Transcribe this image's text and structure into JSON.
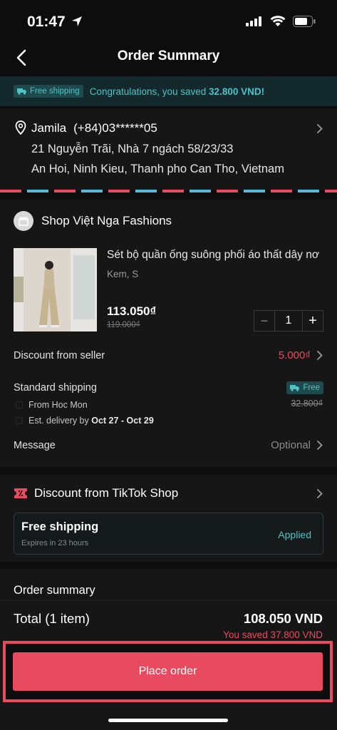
{
  "status": {
    "time": "01:47"
  },
  "header": {
    "title": "Order Summary"
  },
  "banner": {
    "tag": "Free shipping",
    "text": "Congratulations, you saved ",
    "amount": "32.800 VND!"
  },
  "address": {
    "name": "Jamila",
    "phone": "(+84)03******05",
    "line1": "21 Nguyễn Trãi, Nhà 7 ngách 58/23/33",
    "line2": "An Hoi, Ninh Kieu, Thanh pho Can Tho, Vietnam"
  },
  "shop": {
    "name": "Shop Việt Nga Fashions",
    "product": {
      "title": "Sét bộ quần ống suông phối áo thất dây nơ",
      "variant": "Kem, S",
      "price": "113.050₫",
      "original_price": "119.000₫",
      "quantity": "1",
      "minus": "−",
      "plus": "+"
    },
    "discount": {
      "label": "Discount from seller",
      "value": "5.000₫"
    },
    "shipping": {
      "label": "Standard shipping",
      "from": "From Hoc Mon",
      "est_prefix": "Est. delivery by ",
      "est_dates": "Oct 27 - Oct 29",
      "tag": "Free",
      "original": "32.800₫"
    },
    "message": {
      "label": "Message",
      "value": "Optional"
    }
  },
  "tiktok_discount": {
    "title": "Discount from TikTok Shop",
    "coupon": {
      "title": "Free shipping",
      "expires": "Expires in 23 hours",
      "status": "Applied"
    }
  },
  "summary": {
    "title": "Order summary",
    "total_label": "Total (1 item)",
    "total_value": "108.050 VND",
    "saved": "You saved 37.800 VND",
    "button": "Place order"
  },
  "colors": {
    "accent": "#e84a5f",
    "teal": "#4fc2c6",
    "background": "#0d0d0d",
    "card": "#161616"
  }
}
